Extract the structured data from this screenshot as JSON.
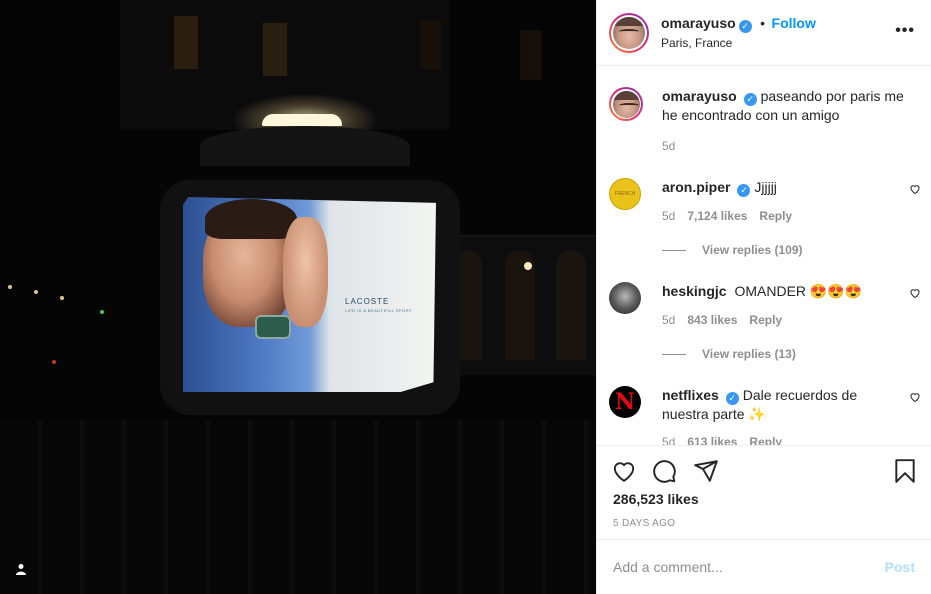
{
  "post": {
    "username": "omarayuso",
    "follow_label": "Follow",
    "follow_separator": "•",
    "location": "Paris, France",
    "more_label": "•••"
  },
  "caption": {
    "username": "omarayuso",
    "text": "paseando por paris me he encontrado con un amigo",
    "age": "5d"
  },
  "comments": [
    {
      "username": "aron.piper",
      "verified": true,
      "text": "Jjjjjj",
      "age": "5d",
      "likes": "7,124 likes",
      "reply_label": "Reply",
      "view_replies": "View replies (109)",
      "avatar_text": "FRENCH"
    },
    {
      "username": "heskingjc",
      "verified": false,
      "text": "OMANDER 😍😍😍",
      "age": "5d",
      "likes": "843 likes",
      "reply_label": "Reply",
      "view_replies": "View replies (13)"
    },
    {
      "username": "netflixes",
      "verified": true,
      "text": "Dale recuerdos de nuestra parte ✨",
      "age": "5d",
      "likes": "613 likes",
      "reply_label": "Reply",
      "avatar_text": "N"
    }
  ],
  "stats": {
    "likes": "286,523 likes",
    "age": "5 DAYS AGO"
  },
  "composer": {
    "placeholder": "Add a comment...",
    "post_label": "Post"
  },
  "photo": {
    "ad_brand": "LACOSTE",
    "ad_tagline": "LIFE IS A BEAUTIFUL SPORT"
  },
  "icons": {
    "verified": "verified-badge-icon",
    "heart": "heart-icon",
    "comment": "comment-icon",
    "share": "share-icon",
    "save": "bookmark-icon",
    "more": "more-options-icon",
    "user_tag": "user-tag-icon"
  },
  "colors": {
    "accent": "#0095f6",
    "verified": "#3897f0",
    "muted": "#8e8e8e",
    "post_disabled": "#b2dffc"
  }
}
